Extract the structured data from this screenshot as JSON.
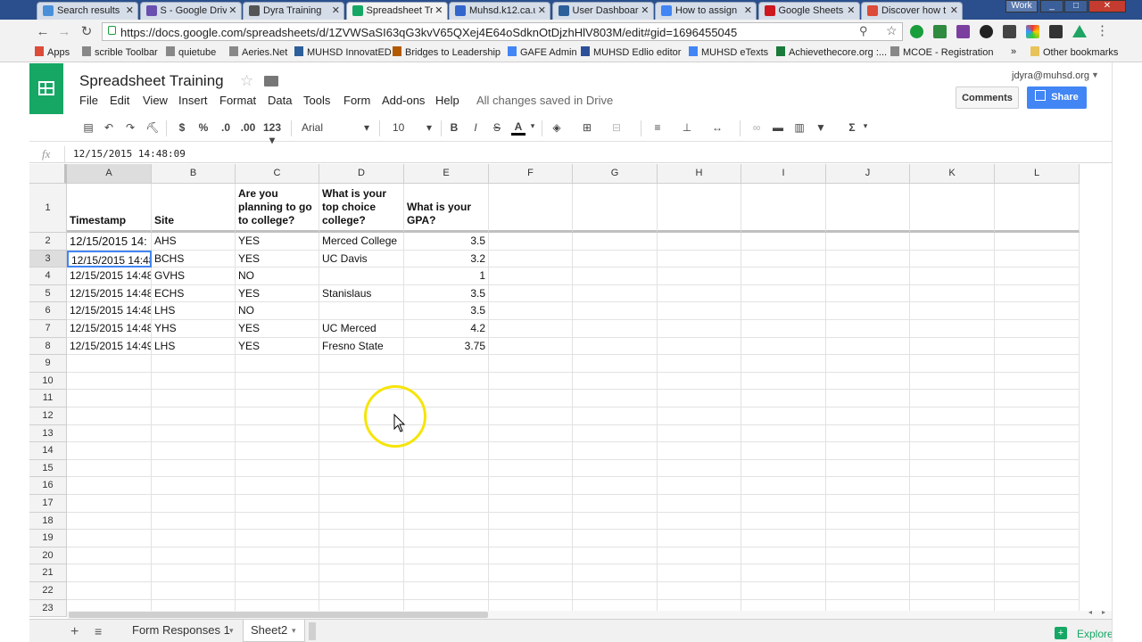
{
  "browser": {
    "tabs": [
      {
        "title": "Search results",
        "color": "#4a90d9"
      },
      {
        "title": "S - Google Driv",
        "color": "#6a4fb0"
      },
      {
        "title": "Dyra Training",
        "color": "#555555"
      },
      {
        "title": "Spreadsheet Tr",
        "color": "#16a765"
      },
      {
        "title": "Muhsd.k12.ca.u",
        "color": "#3366cc"
      },
      {
        "title": "User Dashboar",
        "color": "#2d5f9a"
      },
      {
        "title": "How to assign",
        "color": "#4285f4"
      },
      {
        "title": "Google Sheets",
        "color": "#cc181e"
      },
      {
        "title": "Discover how t",
        "color": "#dd4b39"
      }
    ],
    "profile_label": "Work",
    "url": "https://docs.google.com/spreadsheets/d/1ZVWSaSI63qG3kvV65QXej4E64oSdknOtDjzhHlV803M/edit#gid=1696455045",
    "bookmarks": [
      "Apps",
      "scrible Toolbar",
      "quietube",
      "Aeries.Net",
      "MUHSD InnovatED",
      "Bridges to Leadership",
      "GAFE Admin",
      "MUHSD Edlio editor",
      "MUHSD eTexts",
      "Achievethecore.org :...",
      "MCOE - Registration"
    ],
    "bookmarks_overflow": "»",
    "other_bookmarks": "Other bookmarks"
  },
  "sheets": {
    "title": "Spreadsheet Training",
    "user": "jdyra@muhsd.org",
    "menus": [
      "File",
      "Edit",
      "View",
      "Insert",
      "Format",
      "Data",
      "Tools",
      "Form",
      "Add-ons",
      "Help"
    ],
    "save_status": "All changes saved in Drive",
    "comments_label": "Comments",
    "share_label": "Share",
    "toolbar": {
      "currency": "$",
      "percent": "%",
      "dec_decrease": ".0",
      "dec_increase": ".00",
      "number_format": "123",
      "font": "Arial",
      "font_size": "10",
      "bold": "B",
      "italic": "I",
      "strike": "S",
      "text_color": "A",
      "sum": "Σ"
    },
    "formula": {
      "fx": "fx",
      "value": "12/15/2015 14:48:09"
    },
    "columns": [
      "A",
      "B",
      "C",
      "D",
      "E",
      "F",
      "G",
      "H",
      "I",
      "J",
      "K",
      "L"
    ],
    "rows": [
      "1",
      "2",
      "3",
      "4",
      "5",
      "6",
      "7",
      "8",
      "9",
      "10",
      "11",
      "12",
      "13",
      "14",
      "15",
      "16",
      "17",
      "18",
      "19",
      "20",
      "21",
      "22",
      "23"
    ],
    "header_row": [
      "Timestamp",
      "Site",
      "Are you planning to go to college?",
      "What is your top choice college?",
      "What is your GPA?"
    ],
    "data_rows": [
      [
        "12/15/2015 14:",
        "AHS",
        "YES",
        "Merced College",
        "3.5"
      ],
      [
        "12/15/2015 14:48",
        "BCHS",
        "YES",
        "UC Davis",
        "3.2"
      ],
      [
        "12/15/2015 14:48",
        "GVHS",
        "NO",
        "",
        "1"
      ],
      [
        "12/15/2015 14:48",
        "ECHS",
        "YES",
        "Stanislaus",
        "3.5"
      ],
      [
        "12/15/2015 14:48",
        "LHS",
        "NO",
        "",
        "3.5"
      ],
      [
        "12/15/2015 14:48",
        "YHS",
        "YES",
        "UC Merced",
        "4.2"
      ],
      [
        "12/15/2015 14:49",
        "LHS",
        "YES",
        "Fresno State",
        "3.75"
      ]
    ],
    "sheet_tabs": [
      "Form Responses 1",
      "Sheet2"
    ],
    "active_sheet": "Sheet2",
    "explore_label": "Explore"
  }
}
